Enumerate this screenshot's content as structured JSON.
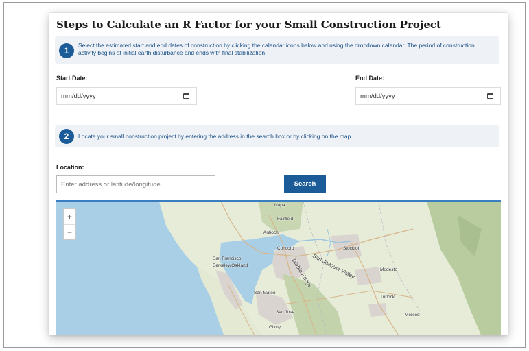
{
  "title": "Steps to Calculate an R Factor for your Small Construction Project",
  "step1": {
    "number": "1",
    "text": "Select the estimated start and end dates of construction by clicking the calendar icons below and using the dropdown calendar. The period of construction activity begins at initial earth disturbance and ends with final stabilization."
  },
  "dates": {
    "start_label": "Start Date:",
    "start_placeholder": "mm/dd/yyyy",
    "end_label": "End Date:",
    "end_placeholder": "mm/dd/yyyy"
  },
  "step2": {
    "number": "2",
    "text": "Locate your small construction project by entering the address in the search box or by clicking on the map."
  },
  "location": {
    "label": "Location:",
    "placeholder": "Enter address or latitude/longitude",
    "search_label": "Search"
  },
  "map": {
    "zoom_in": "+",
    "zoom_out": "−",
    "places": {
      "napa": "Napa",
      "fairfield": "Fairfield",
      "antioch": "Antioch",
      "concord": "Concord",
      "stockton": "Stockton",
      "sf": "San Francisco",
      "berkeley": "Berkeley/Oakland",
      "modesto": "Modesto",
      "san_mateo": "San Mateo",
      "turlock": "Turlock",
      "san_jose": "San Jose",
      "merced": "Merced",
      "gilroy": "Gilroy"
    },
    "regions": {
      "diablo": "Diablo Range",
      "valley": "San Joaquin Valley"
    },
    "colors": {
      "water": "#a9cfe6",
      "land": "#e7ecd8",
      "urban": "#d9d4cf",
      "mountain": "#b9cca0"
    }
  }
}
